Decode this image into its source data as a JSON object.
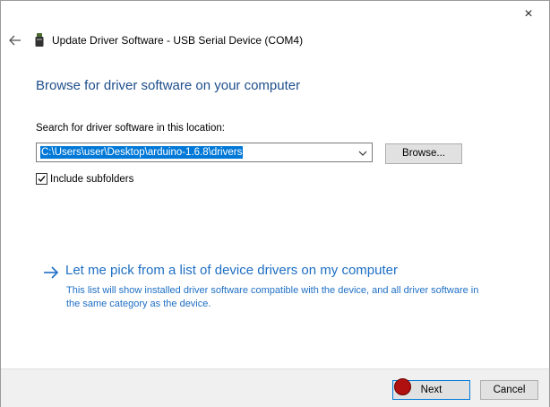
{
  "window": {
    "title": "Update Driver Software - USB Serial Device (COM4)",
    "close_icon": "×"
  },
  "heading": "Browse for driver software on your computer",
  "search": {
    "label": "Search for driver software in this location:",
    "path_value": "C:\\Users\\user\\Desktop\\arduino-1.6.8\\drivers",
    "browse_label": "Browse..."
  },
  "subfolders": {
    "label": "Include subfolders",
    "checked": true
  },
  "pick": {
    "link": "Let me pick from a list of device drivers on my computer",
    "description": "This list will show installed driver software compatible with the device, and all driver software in the same category as the device."
  },
  "footer": {
    "next_label": "Next",
    "cancel_label": "Cancel"
  },
  "icons": {
    "back": "back-arrow-icon",
    "device": "usb-device-icon",
    "close": "close-icon",
    "dropdown": "chevron-down-icon",
    "checkbox": "checkmark-icon",
    "pick": "right-arrow-icon"
  },
  "colors": {
    "heading": "#1e4e8c",
    "link": "#1e6fc4",
    "selection": "#0078d7",
    "cursor": "#b01010"
  }
}
